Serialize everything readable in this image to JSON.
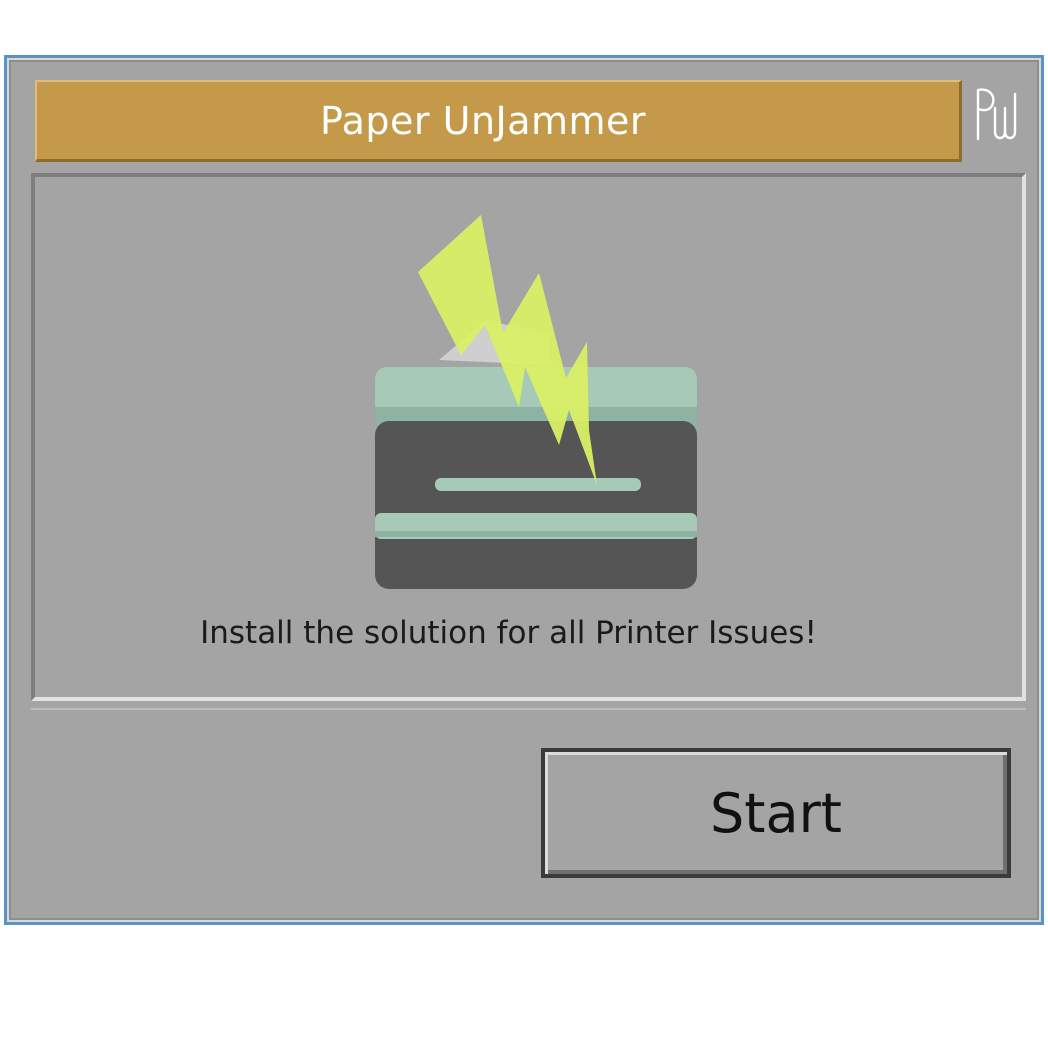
{
  "window": {
    "title": "Paper UnJammer",
    "logo_text": "PUJ",
    "tagline": "Install the solution for all Printer Issues!",
    "start_button_label": "Start"
  },
  "icons": {
    "logo": "puj-logo-icon",
    "illustration": "jammed-printer-lightning-icon"
  },
  "colors": {
    "title_bar": "#c49a4a",
    "window_bg": "#a4a4a4",
    "window_border": "#5b93c7",
    "lightning": "#d9f066",
    "printer_body": "#555555",
    "printer_accent": "#a6c9b8"
  }
}
